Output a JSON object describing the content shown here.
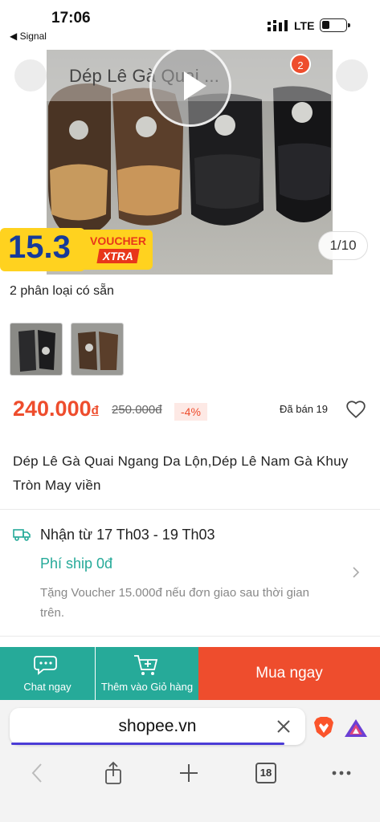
{
  "status_bar": {
    "time": "17:06",
    "back_app": "◀ Signal",
    "network": "LTE"
  },
  "hero": {
    "title": "Dép Lê Gà Quai ...",
    "cart_count": "2",
    "voucher_number": "15.3",
    "voucher_label": "VOUCHER",
    "voucher_tag": "XTRA",
    "image_position": "1/10"
  },
  "variants": {
    "label": "2 phân loại có sẵn"
  },
  "pricing": {
    "price": "240.000",
    "currency": "đ",
    "old_price": "250.000đ",
    "discount": "-4%",
    "sold": "Đã bán 19"
  },
  "product": {
    "title": "Dép Lê Gà Quai Ngang Da Lộn,Dép Lê Nam Gà Khuy Tròn May viền"
  },
  "shipping": {
    "date": "Nhận từ 17 Th03 - 19 Th03",
    "fee": "Phí ship 0đ",
    "note": "Tặng Voucher 15.000đ nếu đơn giao sau thời gian trên."
  },
  "actions": {
    "chat": "Chat ngay",
    "add_to_cart": "Thêm vào Giỏ hàng",
    "buy_now": "Mua ngay"
  },
  "browser": {
    "url": "shopee.vn",
    "tab_count": "18"
  },
  "colors": {
    "shopee_orange": "#ee4d2d",
    "teal": "#26aa99"
  }
}
